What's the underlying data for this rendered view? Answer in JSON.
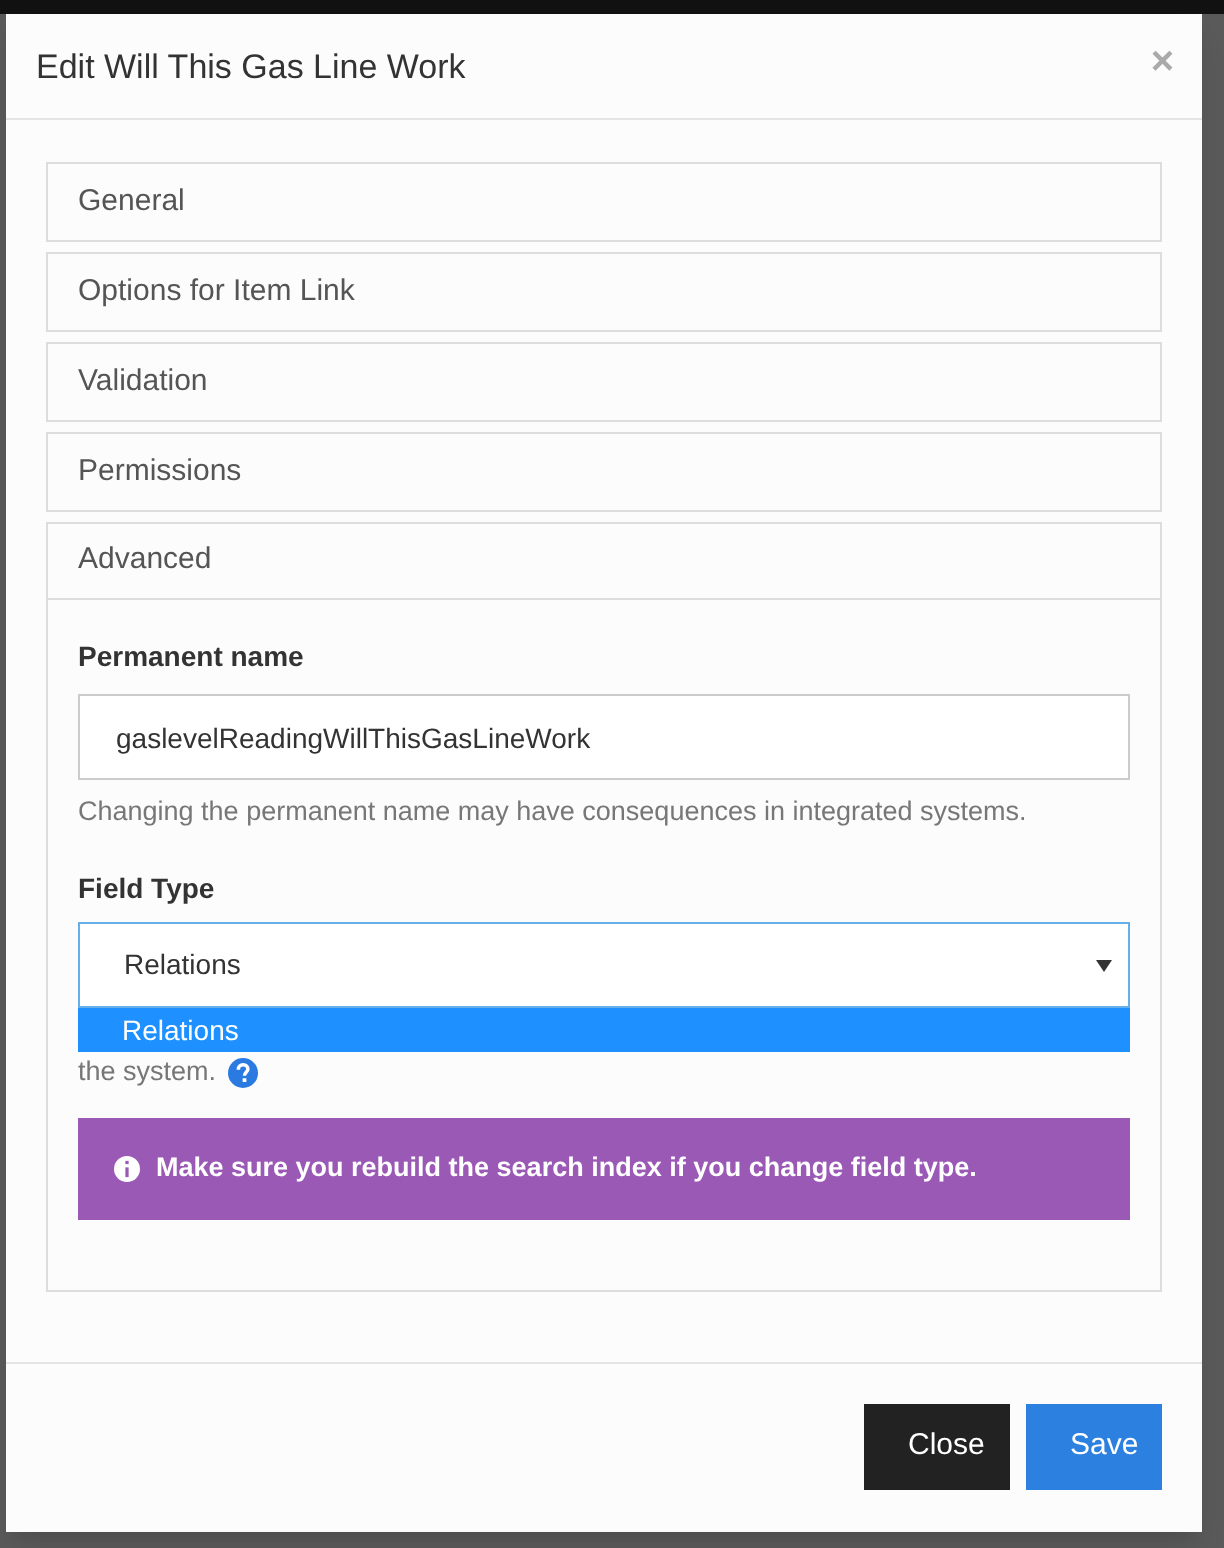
{
  "dialog": {
    "title": "Edit Will This Gas Line Work",
    "close_glyph": "×"
  },
  "sections": [
    {
      "label": "General",
      "expanded": false
    },
    {
      "label": "Options for Item Link",
      "expanded": false
    },
    {
      "label": "Validation",
      "expanded": false
    },
    {
      "label": "Permissions",
      "expanded": false
    },
    {
      "label": "Advanced",
      "expanded": true
    }
  ],
  "advanced": {
    "permanent_name": {
      "label": "Permanent name",
      "value": "gaslevelReadingWillThisGasLineWork",
      "help": "Changing the permanent name may have consequences in integrated systems."
    },
    "field_type": {
      "label": "Field Type",
      "value": "Relations",
      "open": true,
      "options": [
        {
          "label": "Relations",
          "selected": true
        }
      ],
      "help": "the system."
    },
    "alert": "Make sure you rebuild the search index if you change field type."
  },
  "buttons": [
    {
      "label": "Close",
      "kind": "secondary"
    },
    {
      "label": "Save",
      "kind": "primary"
    }
  ]
}
